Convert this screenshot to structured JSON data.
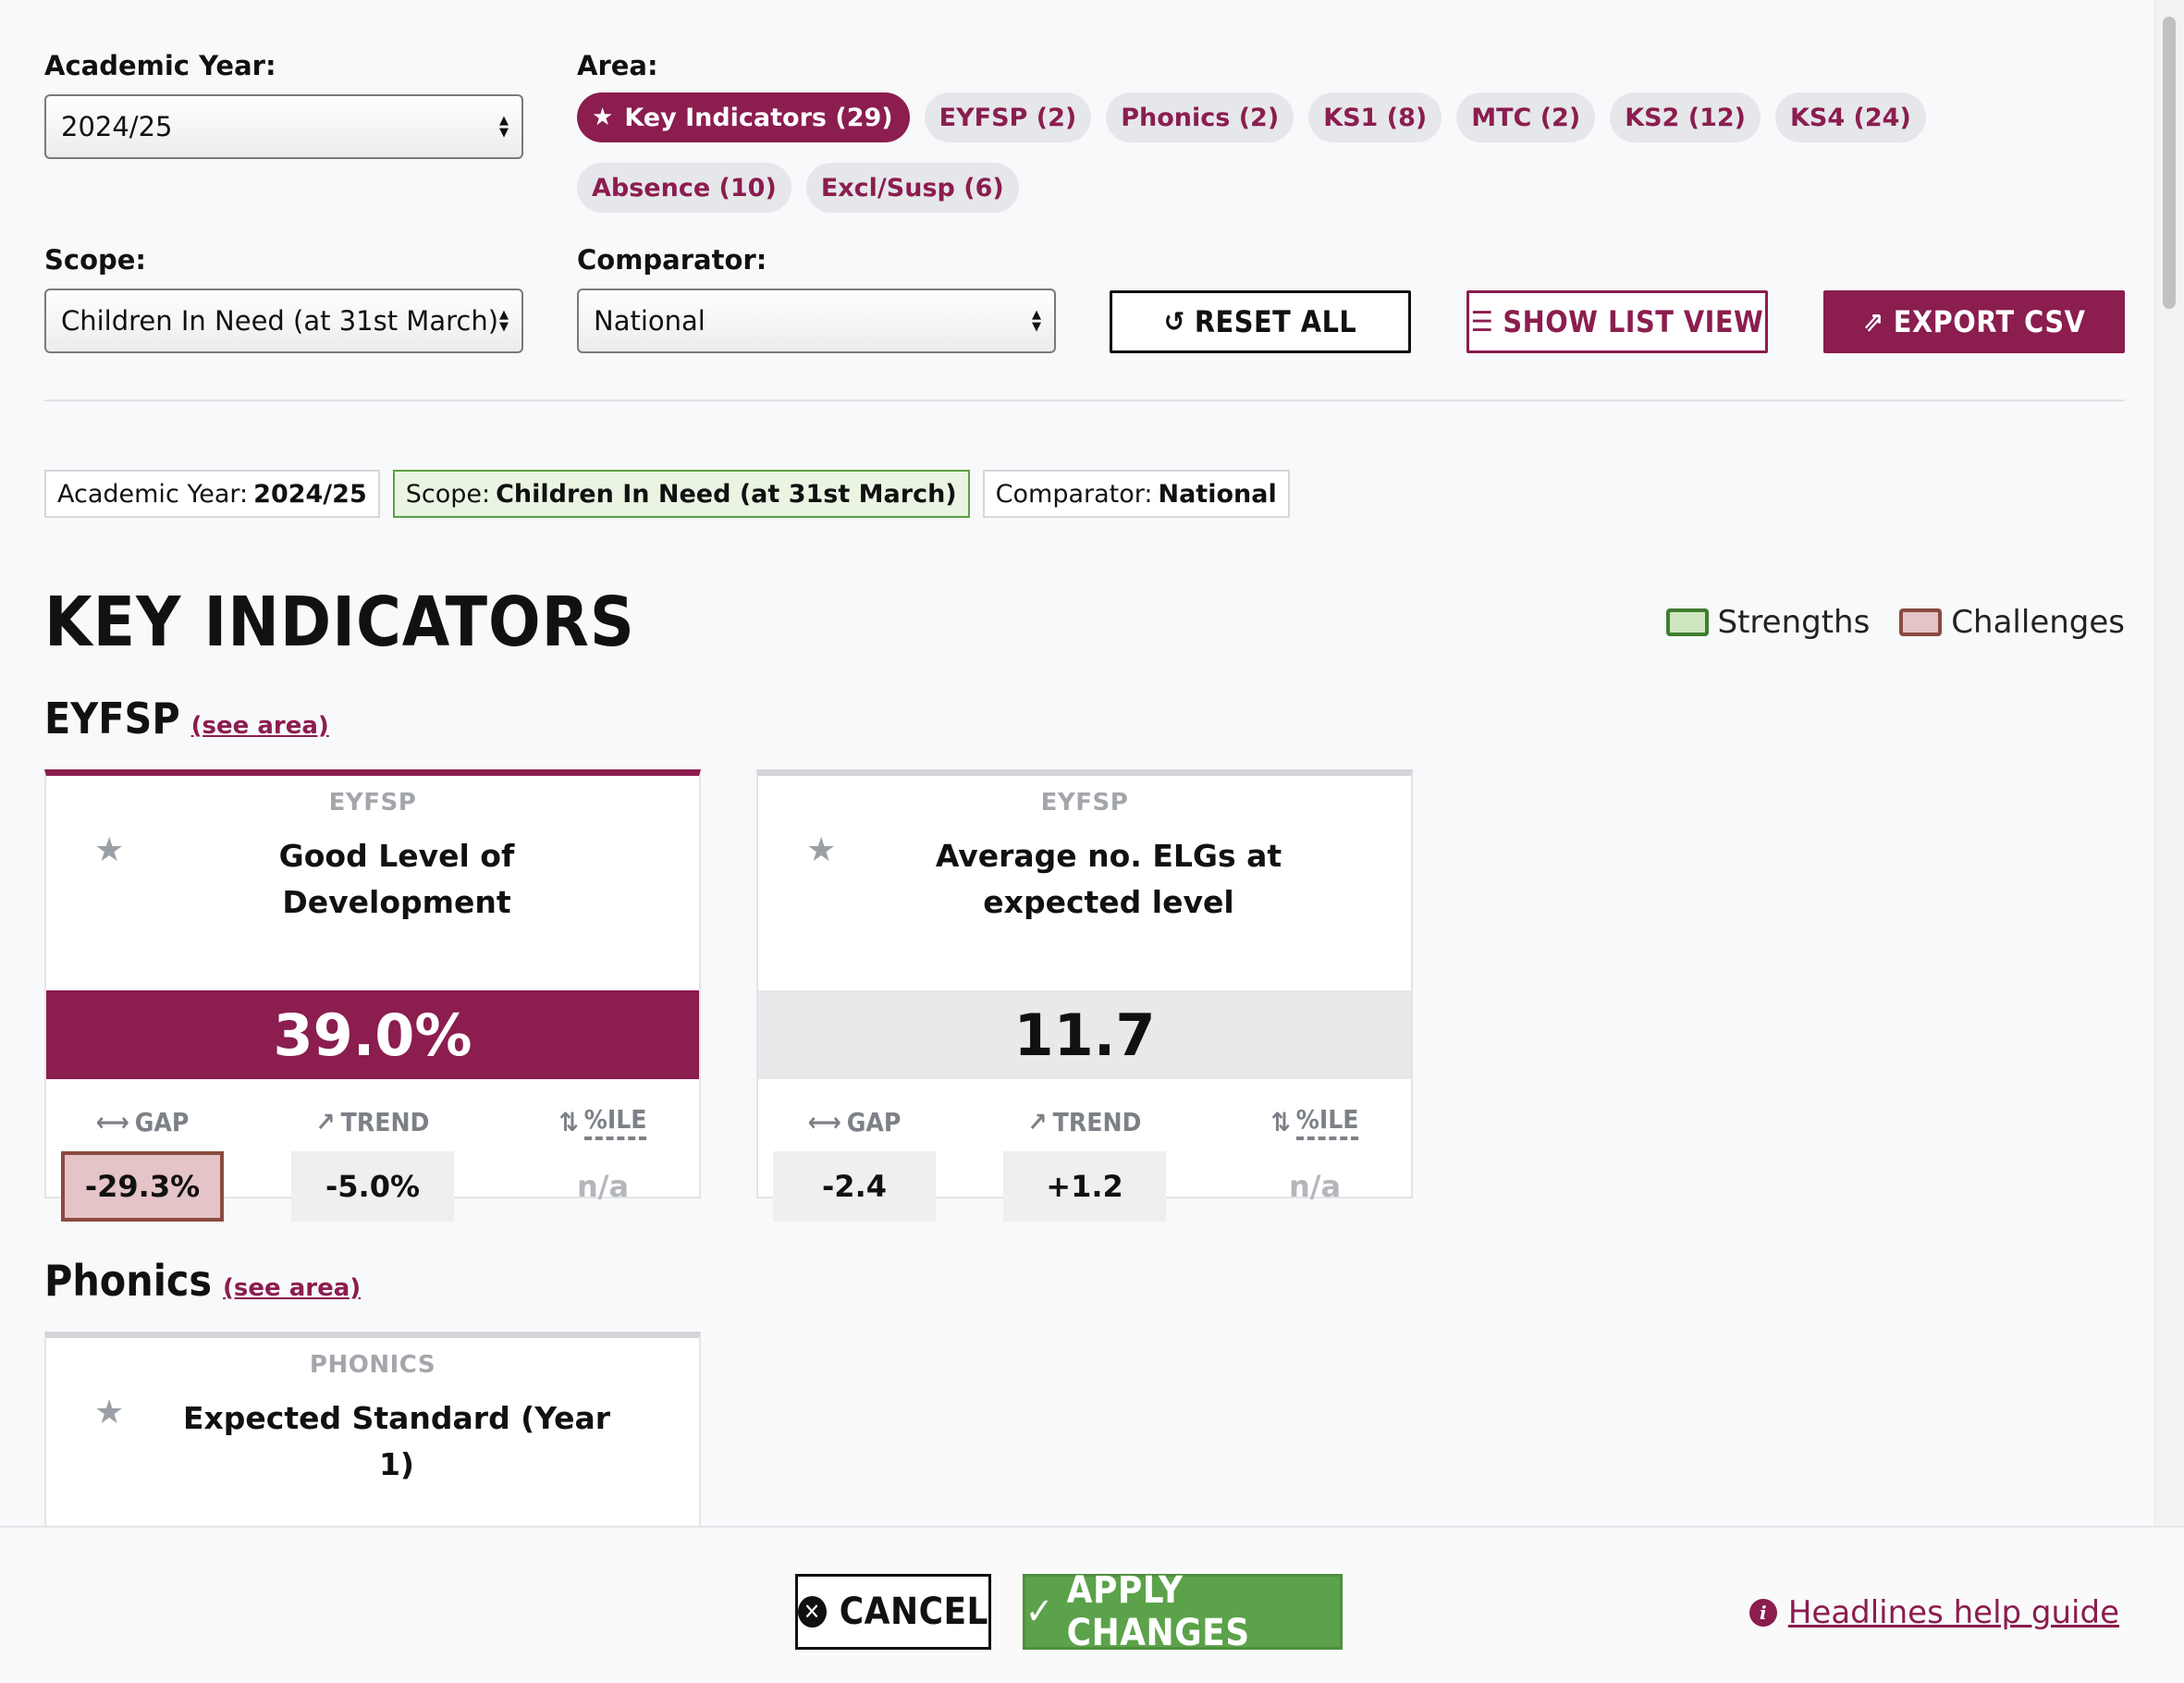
{
  "filters": {
    "academic_year": {
      "label": "Academic Year:",
      "value": "2024/25"
    },
    "area": {
      "label": "Area:",
      "pills": [
        {
          "label": "Key Indicators (29)",
          "active": true
        },
        {
          "label": "EYFSP (2)"
        },
        {
          "label": "Phonics (2)"
        },
        {
          "label": "KS1 (8)"
        },
        {
          "label": "MTC (2)"
        },
        {
          "label": "KS2 (12)"
        },
        {
          "label": "KS4 (24)"
        },
        {
          "label": "Absence (10)"
        },
        {
          "label": "Excl/Susp (6)"
        }
      ]
    },
    "scope": {
      "label": "Scope:",
      "value": "Children In Need (at 31st March)"
    },
    "comparator": {
      "label": "Comparator:",
      "value": "National"
    }
  },
  "buttons": {
    "reset": "RESET ALL",
    "list": "SHOW LIST VIEW",
    "export": "EXPORT CSV"
  },
  "chips": {
    "year": {
      "key": "Academic Year:",
      "value": "2024/25"
    },
    "scope": {
      "key": "Scope:",
      "value": "Children In Need (at 31st March)"
    },
    "comparator": {
      "key": "Comparator:",
      "value": "National"
    }
  },
  "main": {
    "title": "KEY INDICATORS",
    "legend": {
      "strengths": "Strengths",
      "challenges": "Challenges"
    },
    "metric_labels": {
      "gap": "GAP",
      "trend": "TREND",
      "pctile": "%ILE"
    },
    "sections": [
      {
        "title": "EYFSP",
        "see_area": "(see area)",
        "cards": [
          {
            "category": "EYFSP",
            "title": "Good Level of Development",
            "value": "39.0%",
            "gap": "-29.3%",
            "trend": "-5.0%",
            "pctile": "n/a"
          },
          {
            "category": "EYFSP",
            "title": "Average no. ELGs at expected level",
            "value": "11.7",
            "gap": "-2.4",
            "trend": "+1.2",
            "pctile": "n/a"
          }
        ]
      },
      {
        "title": "Phonics",
        "see_area": "(see area)",
        "cards": [
          {
            "category": "PHONICS",
            "title": "Expected Standard (Year 1)"
          }
        ]
      }
    ]
  },
  "footer": {
    "cancel": "CANCEL",
    "apply": "APPLY CHANGES",
    "help": "Headlines help guide"
  },
  "icons": {
    "star": "star-icon",
    "reset": "refresh-icon",
    "list": "list-icon",
    "export": "export-icon",
    "gap": "double-arrow-icon",
    "trend": "trend-icon",
    "pctile": "sort-arrows-icon",
    "cancel": "x-circle-icon",
    "apply": "check-icon",
    "help": "info-icon"
  },
  "colors": {
    "brand": "#8b1d4f",
    "strength": "#3f7d2e",
    "challenge": "#8b4a40",
    "apply": "#5ba24a"
  }
}
